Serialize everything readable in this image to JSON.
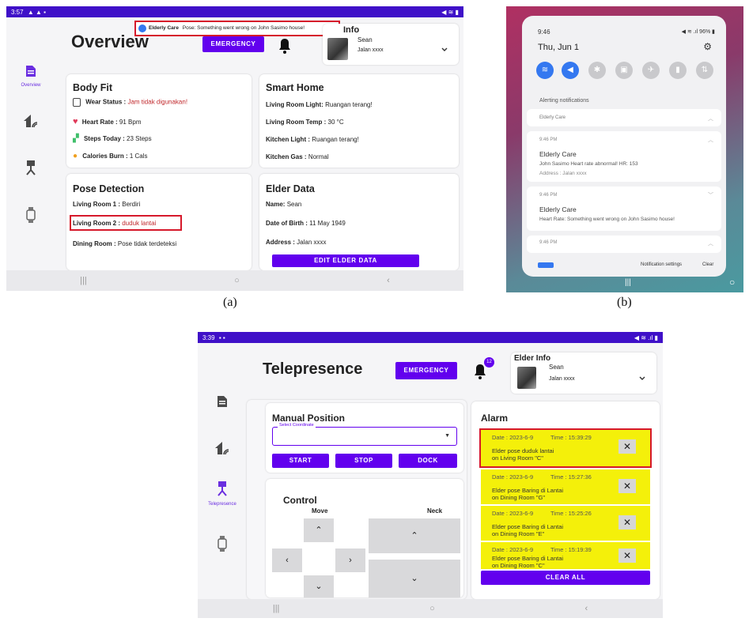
{
  "panel_a": {
    "status_time": "3:57",
    "status_icons_left": "▲ ▲ ▪",
    "status_icons_right": "◀ ≋ ▮",
    "title": "Overview",
    "emergency_label": "EMERGENCY",
    "notification_app": "Elderly Care",
    "notification_text": "Pose: Something went wrong on John Sasimo house!",
    "elder_info_title": "Info",
    "elder_name": "Sean",
    "elder_address": "Jalan xxxx",
    "nav_overview_label": "Overview",
    "body_fit": {
      "title": "Body Fit",
      "wear_label": "Wear Status :",
      "wear_value": "Jam tidak digunakan!",
      "heart_label": "Heart Rate :",
      "heart_value": "91 Bpm",
      "steps_label": "Steps Today :",
      "steps_value": "23 Steps",
      "calories_label": "Calories Burn :",
      "calories_value": "1 Cals"
    },
    "smart_home": {
      "title": "Smart Home",
      "lr_light_label": "Living Room Light:",
      "lr_light_value": "Ruangan terang!",
      "lr_temp_label": "Living Room Temp :",
      "lr_temp_value": "30 °C",
      "k_light_label": "Kitchen Light :",
      "k_light_value": "Ruangan terang!",
      "k_gas_label": "Kitchen Gas :",
      "k_gas_value": "Normal"
    },
    "pose": {
      "title": "Pose Detection",
      "room1_label": "Living Room 1 :",
      "room1_value": "Berdiri",
      "room2_label": "Living Room 2 :",
      "room2_value": "duduk lantai",
      "dining_label": "Dining Room :",
      "dining_value": "Pose tidak terdeteksi"
    },
    "elder_data": {
      "title": "Elder Data",
      "name_label": "Name:",
      "name_value": "Sean",
      "dob_label": "Date of Birth :",
      "dob_value": "11 May 1949",
      "address_label": "Address :",
      "address_value": "Jalan xxxx",
      "edit_label": "EDIT ELDER DATA"
    },
    "sysnav": {
      "recents": "|||",
      "home": "○",
      "back": "‹"
    }
  },
  "panel_b": {
    "time": "9:46",
    "status_right": "◀ ≋ .ıl 96% ▮",
    "date": "Thu, Jun 1",
    "settings_icon": "⚙",
    "alerting_header": "Alerting notifications",
    "group_app": "Elderly Care",
    "n1_time": "9:46 PM",
    "n1_title": "Elderly Care",
    "n1_body": "John Sasimo Heart rate abnormal! HR: 153",
    "n1_sub": "Address : Jalan xxxx",
    "n2_time": "9:46 PM",
    "n2_title": "Elderly Care",
    "n2_body": "Heart Rate: Something went wrong on John Sasimo house!",
    "n3_time": "9:46 PM",
    "footer_settings": "Notification settings",
    "footer_clear": "Clear",
    "nav_recents": "|||",
    "nav_home": "○"
  },
  "captions": {
    "a": "(a)",
    "b": "(b)"
  },
  "panel_c": {
    "status_time": "3:39",
    "status_icons_left": "▪ ▪",
    "status_icons_right": "◀ ≋ .ıl ▮",
    "title": "Telepresence",
    "emergency_label": "EMERGENCY",
    "bell_badge": "12",
    "elder_info_title": "Elder Info",
    "elder_name": "Sean",
    "elder_address": "Jalan xxxx",
    "nav_telepresence_label": "Telepresence",
    "manual_title": "Manual Position",
    "select_label": "Select Coordinate",
    "start_label": "START",
    "stop_label": "STOP",
    "dock_label": "DOCK",
    "control_title": "Control",
    "move_label": "Move",
    "neck_label": "Neck",
    "alarm_title": "Alarm",
    "alarms": [
      {
        "date": "Date : 2023-6-9",
        "time": "Time : 15:39:29",
        "msg1": "Elder pose duduk lantai",
        "msg2": "on Living Room \"C\""
      },
      {
        "date": "Date : 2023-6-9",
        "time": "Time : 15:27:36",
        "msg1": "Elder pose Baring di Lantai",
        "msg2": "on Dining Room \"G\""
      },
      {
        "date": "Date : 2023-6-9",
        "time": "Time : 15:25:26",
        "msg1": "Elder pose Baring di Lantai",
        "msg2": "on Dining Room \"E\""
      },
      {
        "date": "Date : 2023-6-9",
        "time": "Time : 15:19:39",
        "msg1": "Elder pose Baring di Lantai",
        "msg2": "on Dining Room \"C\""
      }
    ],
    "clear_all_label": "CLEAR ALL",
    "close_glyph": "✕",
    "sysnav": {
      "recents": "|||",
      "home": "○",
      "back": "‹"
    }
  },
  "colors": {
    "accent": "#6200ee",
    "statusbar": "#3f10c8",
    "alarm": "#f4f00a",
    "highlight": "#d6192b"
  }
}
